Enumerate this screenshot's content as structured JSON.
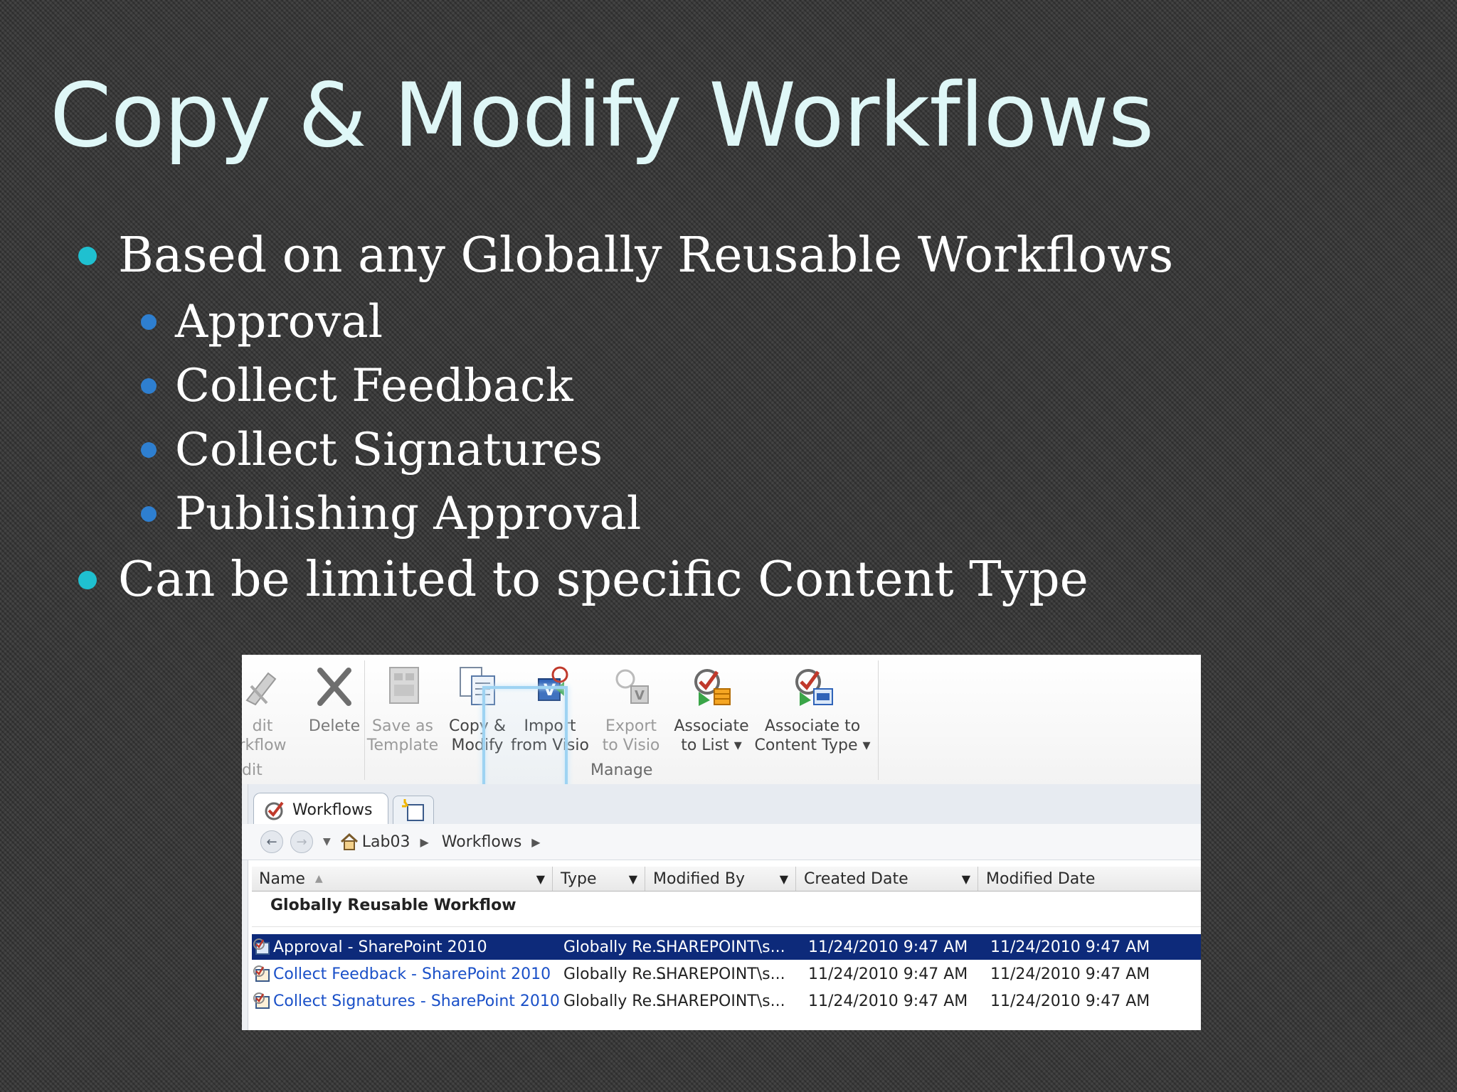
{
  "slide": {
    "title": "Copy & Modify Workflows",
    "bullets": [
      {
        "level": 1,
        "text": "Based on any Globally Reusable Workflows"
      },
      {
        "level": 2,
        "text": "Approval"
      },
      {
        "level": 2,
        "text": "Collect Feedback"
      },
      {
        "level": 2,
        "text": "Collect Signatures"
      },
      {
        "level": 2,
        "text": "Publishing Approval"
      },
      {
        "level": 1,
        "text": "Can be limited to specific Content Type"
      }
    ]
  },
  "ribbon": {
    "edit_workflow": {
      "line1": "dit",
      "line2": "rkflow",
      "icon": "edit-workflow-icon"
    },
    "edit_group_label": "dit",
    "delete": {
      "line1": "Delete",
      "line2": "",
      "icon": "delete-x-icon"
    },
    "save_as_template": {
      "line1": "Save as",
      "line2": "Template",
      "icon": "save-template-icon"
    },
    "copy_modify": {
      "line1": "Copy &",
      "line2": "Modify",
      "icon": "copy-modify-icon"
    },
    "import_visio": {
      "line1": "Import",
      "line2": "from Visio",
      "icon": "import-visio-icon"
    },
    "export_visio": {
      "line1": "Export",
      "line2": "to Visio",
      "icon": "export-visio-icon"
    },
    "associate_list": {
      "line1": "Associate",
      "line2": "to List ▾",
      "icon": "associate-list-icon"
    },
    "associate_ct": {
      "line1": "Associate to",
      "line2": "Content Type ▾",
      "icon": "associate-content-type-icon"
    },
    "manage_group_label": "Manage"
  },
  "tabs": {
    "active": "Workflows",
    "new_tab_icon": "new-tab-icon"
  },
  "breadcrumb": {
    "items": [
      "Lab03",
      "Workflows"
    ]
  },
  "grid": {
    "columns": [
      "Name",
      "Type",
      "Modified By",
      "Created Date",
      "Modified Date"
    ],
    "group": "Globally Reusable Workflow",
    "rows": [
      {
        "name": "Approval - SharePoint 2010",
        "type": "Globally Re...",
        "modified_by": "SHAREPOINT\\s...",
        "created": "11/24/2010 9:47 AM",
        "modified": "11/24/2010 9:47 AM",
        "selected": true
      },
      {
        "name": "Collect Feedback - SharePoint 2010",
        "type": "Globally Re...",
        "modified_by": "SHAREPOINT\\s...",
        "created": "11/24/2010 9:47 AM",
        "modified": "11/24/2010 9:47 AM",
        "selected": false
      },
      {
        "name": "Collect Signatures - SharePoint 2010",
        "type": "Globally Re...",
        "modified_by": "SHAREPOINT\\s...",
        "created": "11/24/2010 9:47 AM",
        "modified": "11/24/2010 9:47 AM",
        "selected": false
      }
    ]
  },
  "colors": {
    "title": "#dff7f7",
    "bullet_level1": "#1fc0d0",
    "bullet_level2": "#2e7fd0",
    "selection": "#0d2a7a",
    "link": "#1a50c8"
  }
}
